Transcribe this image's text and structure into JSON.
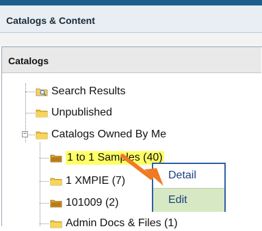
{
  "section": {
    "title": "Catalogs & Content"
  },
  "panel": {
    "title": "Catalogs"
  },
  "tree": {
    "search_results": "Search Results",
    "unpublished": "Unpublished",
    "owned": "Catalogs Owned By Me",
    "child_1": "1 to 1 Samples (40)",
    "child_2": "1 XMPIE (7)",
    "child_3": "101009 (2)",
    "child_4": "Admin Docs & Files (1)"
  },
  "context_menu": {
    "detail": "Detail",
    "edit": "Edit"
  },
  "colors": {
    "accent": "#1d5e8c",
    "selection_highlight": "#ffff66",
    "menu_border": "#2f5fa3",
    "menu_hover": "#d6e9c4",
    "arrow": "#f07a24"
  }
}
